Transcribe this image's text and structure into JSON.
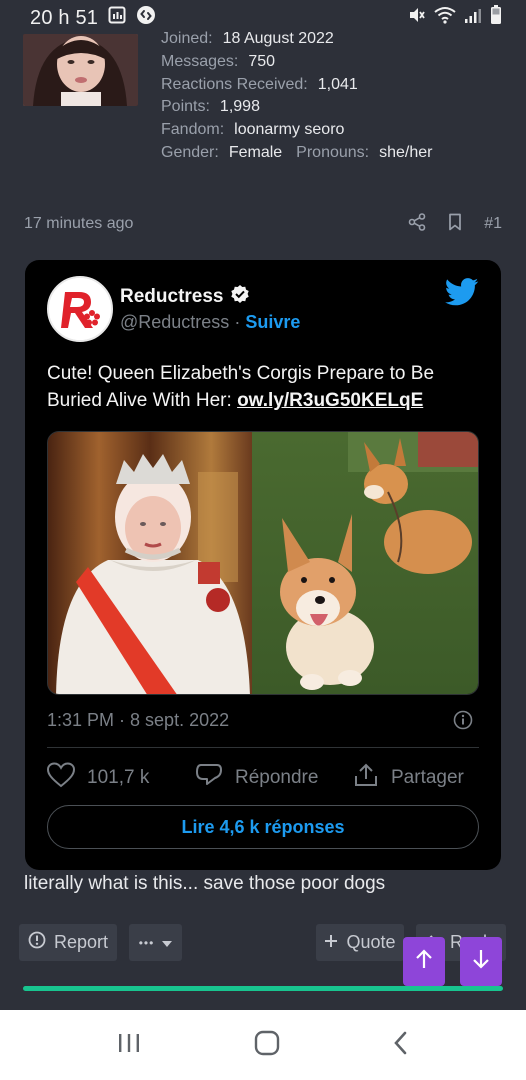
{
  "status_bar": {
    "time": "20 h 51",
    "icons": [
      "gallery-icon",
      "shazam-icon",
      "mute-icon",
      "wifi-icon",
      "signal-icon",
      "battery-icon"
    ]
  },
  "profile": {
    "joined_label": "Joined:",
    "joined_value": "18 August 2022",
    "messages_label": "Messages:",
    "messages_value": "750",
    "reactions_label": "Reactions Received:",
    "reactions_value": "1,041",
    "points_label": "Points:",
    "points_value": "1,998",
    "fandom_label": "Fandom:",
    "fandom_value": "loonarmy seoro",
    "gender_label": "Gender:",
    "gender_value": "Female",
    "pronouns_label": "Pronouns:",
    "pronouns_value": "she/her"
  },
  "post": {
    "time_ago": "17 minutes ago",
    "post_number": "#1",
    "text": "literally what is this... save those poor dogs"
  },
  "tweet": {
    "name": "Reductress",
    "handle": "@Reductress",
    "separator": " · ",
    "follow": "Suivre",
    "text": "Cute! Queen Elizabeth's Corgis Prepare to Be Buried Alive With Her:",
    "link": "ow.ly/R3uG50KELqE",
    "timestamp": "1:31 PM · 8 sept. 2022",
    "likes": "101,7 k",
    "reply": "Répondre",
    "share": "Partager",
    "read_more": "Lire 4,6 k réponses",
    "colors": {
      "accent": "#1d9bf0",
      "logo_red": "#e0222b"
    }
  },
  "actions": {
    "report": "Report",
    "more": "•••",
    "quote": "Quote",
    "reply": "Reply",
    "scroll_progress": 1.0
  },
  "colors": {
    "fab": "#8e45d9",
    "progress": "#18c48f",
    "background": "#2d3039"
  }
}
